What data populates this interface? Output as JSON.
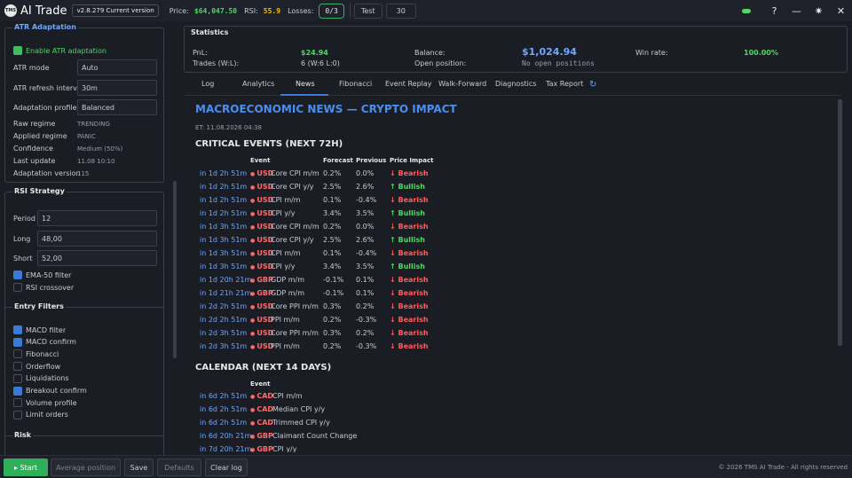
{
  "titlebar": {
    "logo_text": "TMS",
    "app_title": "AI Trade",
    "version": "v2.8.279 Current version",
    "price_label": "Price:",
    "price_value": "$64,047.50",
    "rsi_label": "RSI:",
    "rsi_value": "55.9",
    "losses_label": "Losses:",
    "losses_value": "0/3",
    "test_label": "Test",
    "test_value": "30",
    "icons": [
      "status-indicator",
      "help-icon",
      "minimize-icon",
      "settings-icon",
      "close-icon"
    ],
    "help_glyph": "?",
    "min_glyph": "—",
    "gear_glyph": "✷",
    "close_glyph": "✕"
  },
  "atr": {
    "title": "ATR Adaptation",
    "enable_label": "Enable ATR adaptation",
    "mode_label": "ATR mode",
    "mode_value": "Auto",
    "refresh_label": "ATR refresh interval",
    "refresh_value": "30m",
    "profile_label": "Adaptation profile",
    "profile_value": "Balanced",
    "raw_label": "Raw regime",
    "raw_value": "TRENDING",
    "applied_label": "Applied regime",
    "applied_value": "PANIC",
    "conf_label": "Confidence",
    "conf_value": "Medium (50%)",
    "update_label": "Last update",
    "update_value": "11.08 10:10",
    "adver_label": "Adaptation version",
    "adver_value": "115"
  },
  "rsi": {
    "title": "RSI Strategy",
    "period_label": "Period",
    "period_value": "12",
    "long_label": "Long",
    "long_value": "48,00",
    "short_label": "Short",
    "short_value": "52,00",
    "ema_label": "EMA-50 filter",
    "cross_label": "RSI crossover"
  },
  "entry": {
    "title": "Entry Filters",
    "items": [
      {
        "label": "MACD filter",
        "checked": true
      },
      {
        "label": "MACD confirm",
        "checked": true
      },
      {
        "label": "Fibonacci",
        "checked": false
      },
      {
        "label": "Orderflow",
        "checked": false
      },
      {
        "label": "Liquidations",
        "checked": false
      },
      {
        "label": "Breakout confirm",
        "checked": true
      },
      {
        "label": "Volume profile",
        "checked": false
      },
      {
        "label": "Limit orders",
        "checked": false
      }
    ]
  },
  "risk": {
    "title": "Risk"
  },
  "bottom": {
    "start": "▸ Start",
    "avg": "Average position",
    "save": "Save",
    "defaults": "Defaults",
    "clear": "Clear log",
    "copyright": "© 2026 TMS AI Trade - All rights reserved"
  },
  "stats": {
    "title": "Statistics",
    "pnl_label": "PnL:",
    "pnl_value": "$24.94",
    "trades_label": "Trades (W:L):",
    "trades_value": "6 (W:6 L:0)",
    "balance_label": "Balance:",
    "balance_value": "$1,024.94",
    "open_label": "Open position:",
    "open_value": "No open positions",
    "winrate_label": "Win rate:",
    "winrate_value": "100.00%"
  },
  "tabs": [
    "Log",
    "Analytics",
    "News",
    "Fibonacci",
    "Event Replay",
    "Walk-Forward",
    "Diagnostics",
    "Tax Report"
  ],
  "refresh_glyph": "↻",
  "news": {
    "title": "MACROECONOMIC NEWS — CRYPTO IMPACT",
    "et": "ET: 11.08.2026 04:38",
    "critical_title": "CRITICAL EVENTS (NEXT 72H)",
    "headers": {
      "event": "Event",
      "forecast": "Forecast",
      "previous": "Previous",
      "impact": "Price Impact"
    },
    "critical": [
      {
        "time": "in 1d 2h 51m",
        "cur": "USD",
        "name": "Core CPI m/m",
        "fc": "0.2%",
        "pv": "0.0%",
        "imp": "↓ Bearish",
        "bull": false
      },
      {
        "time": "in 1d 2h 51m",
        "cur": "USD",
        "name": "Core CPI y/y",
        "fc": "2.5%",
        "pv": "2.6%",
        "imp": "↑ Bullish",
        "bull": true
      },
      {
        "time": "in 1d 2h 51m",
        "cur": "USD",
        "name": "CPI m/m",
        "fc": "0.1%",
        "pv": "-0.4%",
        "imp": "↓ Bearish",
        "bull": false
      },
      {
        "time": "in 1d 2h 51m",
        "cur": "USD",
        "name": "CPI y/y",
        "fc": "3.4%",
        "pv": "3.5%",
        "imp": "↑ Bullish",
        "bull": true
      },
      {
        "time": "in 1d 3h 51m",
        "cur": "USD",
        "name": "Core CPI m/m",
        "fc": "0.2%",
        "pv": "0.0%",
        "imp": "↓ Bearish",
        "bull": false
      },
      {
        "time": "in 1d 3h 51m",
        "cur": "USD",
        "name": "Core CPI y/y",
        "fc": "2.5%",
        "pv": "2.6%",
        "imp": "↑ Bullish",
        "bull": true
      },
      {
        "time": "in 1d 3h 51m",
        "cur": "USD",
        "name": "CPI m/m",
        "fc": "0.1%",
        "pv": "-0.4%",
        "imp": "↓ Bearish",
        "bull": false
      },
      {
        "time": "in 1d 3h 51m",
        "cur": "USD",
        "name": "CPI y/y",
        "fc": "3.4%",
        "pv": "3.5%",
        "imp": "↑ Bullish",
        "bull": true
      },
      {
        "time": "in 1d 20h 21m",
        "cur": "GBP",
        "name": "GDP m/m",
        "fc": "-0.1%",
        "pv": "0.1%",
        "imp": "↓ Bearish",
        "bull": false
      },
      {
        "time": "in 1d 21h 21m",
        "cur": "GBP",
        "name": "GDP m/m",
        "fc": "-0.1%",
        "pv": "0.1%",
        "imp": "↓ Bearish",
        "bull": false
      },
      {
        "time": "in 2d 2h 51m",
        "cur": "USD",
        "name": "Core PPI m/m",
        "fc": "0.3%",
        "pv": "0.2%",
        "imp": "↓ Bearish",
        "bull": false
      },
      {
        "time": "in 2d 2h 51m",
        "cur": "USD",
        "name": "PPI m/m",
        "fc": "0.2%",
        "pv": "-0.3%",
        "imp": "↓ Bearish",
        "bull": false
      },
      {
        "time": "in 2d 3h 51m",
        "cur": "USD",
        "name": "Core PPI m/m",
        "fc": "0.3%",
        "pv": "0.2%",
        "imp": "↓ Bearish",
        "bull": false
      },
      {
        "time": "in 2d 3h 51m",
        "cur": "USD",
        "name": "PPI m/m",
        "fc": "0.2%",
        "pv": "-0.3%",
        "imp": "↓ Bearish",
        "bull": false
      }
    ],
    "calendar_title": "CALENDAR (NEXT 14 DAYS)",
    "calendar": [
      {
        "time": "in 6d 2h 51m",
        "cur": "CAD",
        "name": "CPI m/m"
      },
      {
        "time": "in 6d 2h 51m",
        "cur": "CAD",
        "name": "Median CPI y/y"
      },
      {
        "time": "in 6d 2h 51m",
        "cur": "CAD",
        "name": "Trimmed CPI y/y"
      },
      {
        "time": "in 6d 20h 21m",
        "cur": "GBP",
        "name": "Claimant Count Change"
      },
      {
        "time": "in 7d 20h 21m",
        "cur": "GBP",
        "name": "CPI y/y"
      }
    ]
  }
}
